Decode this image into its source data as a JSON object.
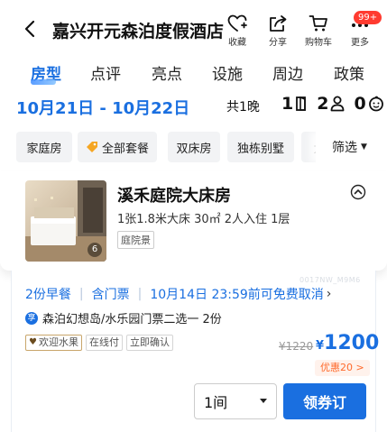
{
  "header": {
    "title": "嘉兴开元森泊度假酒店",
    "actions": [
      {
        "label": "收藏",
        "icon": "heart-plus-icon"
      },
      {
        "label": "分享",
        "icon": "share-icon"
      },
      {
        "label": "购物车",
        "icon": "cart-icon"
      },
      {
        "label": "更多",
        "icon": "more-icon"
      }
    ],
    "badge": "99+"
  },
  "tabs": [
    {
      "label": "房型",
      "active": true
    },
    {
      "label": "点评"
    },
    {
      "label": "亮点"
    },
    {
      "label": "设施"
    },
    {
      "label": "周边"
    },
    {
      "label": "政策"
    }
  ],
  "stay": {
    "date_range": "10月21日 - 10月22日",
    "nights": "共1晚",
    "rooms": "1",
    "adults": "2",
    "children": "0"
  },
  "filters": {
    "chips": [
      "家庭房",
      "全部套餐",
      "双床房",
      "独栋别墅",
      "大"
    ],
    "filter_label": "筛选"
  },
  "room": {
    "name": "溪禾庭院大床房",
    "specs": "1张1.8米大床  30㎡  2人入住  1层",
    "tag": "庭院景",
    "image_count": "6"
  },
  "offer": {
    "watermark": "0017NW_M9M6",
    "breakfast": "2份早餐",
    "ticket": "含门票",
    "cancel": "10月14日 23:59前可免费取消",
    "package_badge": "享",
    "package": "森泊幻想岛/水乐园门票二选一 2份",
    "tags": [
      "欢迎水果",
      "在线付",
      "立即确认"
    ],
    "original_price": "¥1220",
    "currency": "¥",
    "price": "1200",
    "coupon": "优惠20 >",
    "quantity": "1间",
    "book_label": "领券订"
  },
  "colors": {
    "accent": "#1a6fe0",
    "badge": "#ff3b30",
    "coupon": "#ff6a2b"
  }
}
